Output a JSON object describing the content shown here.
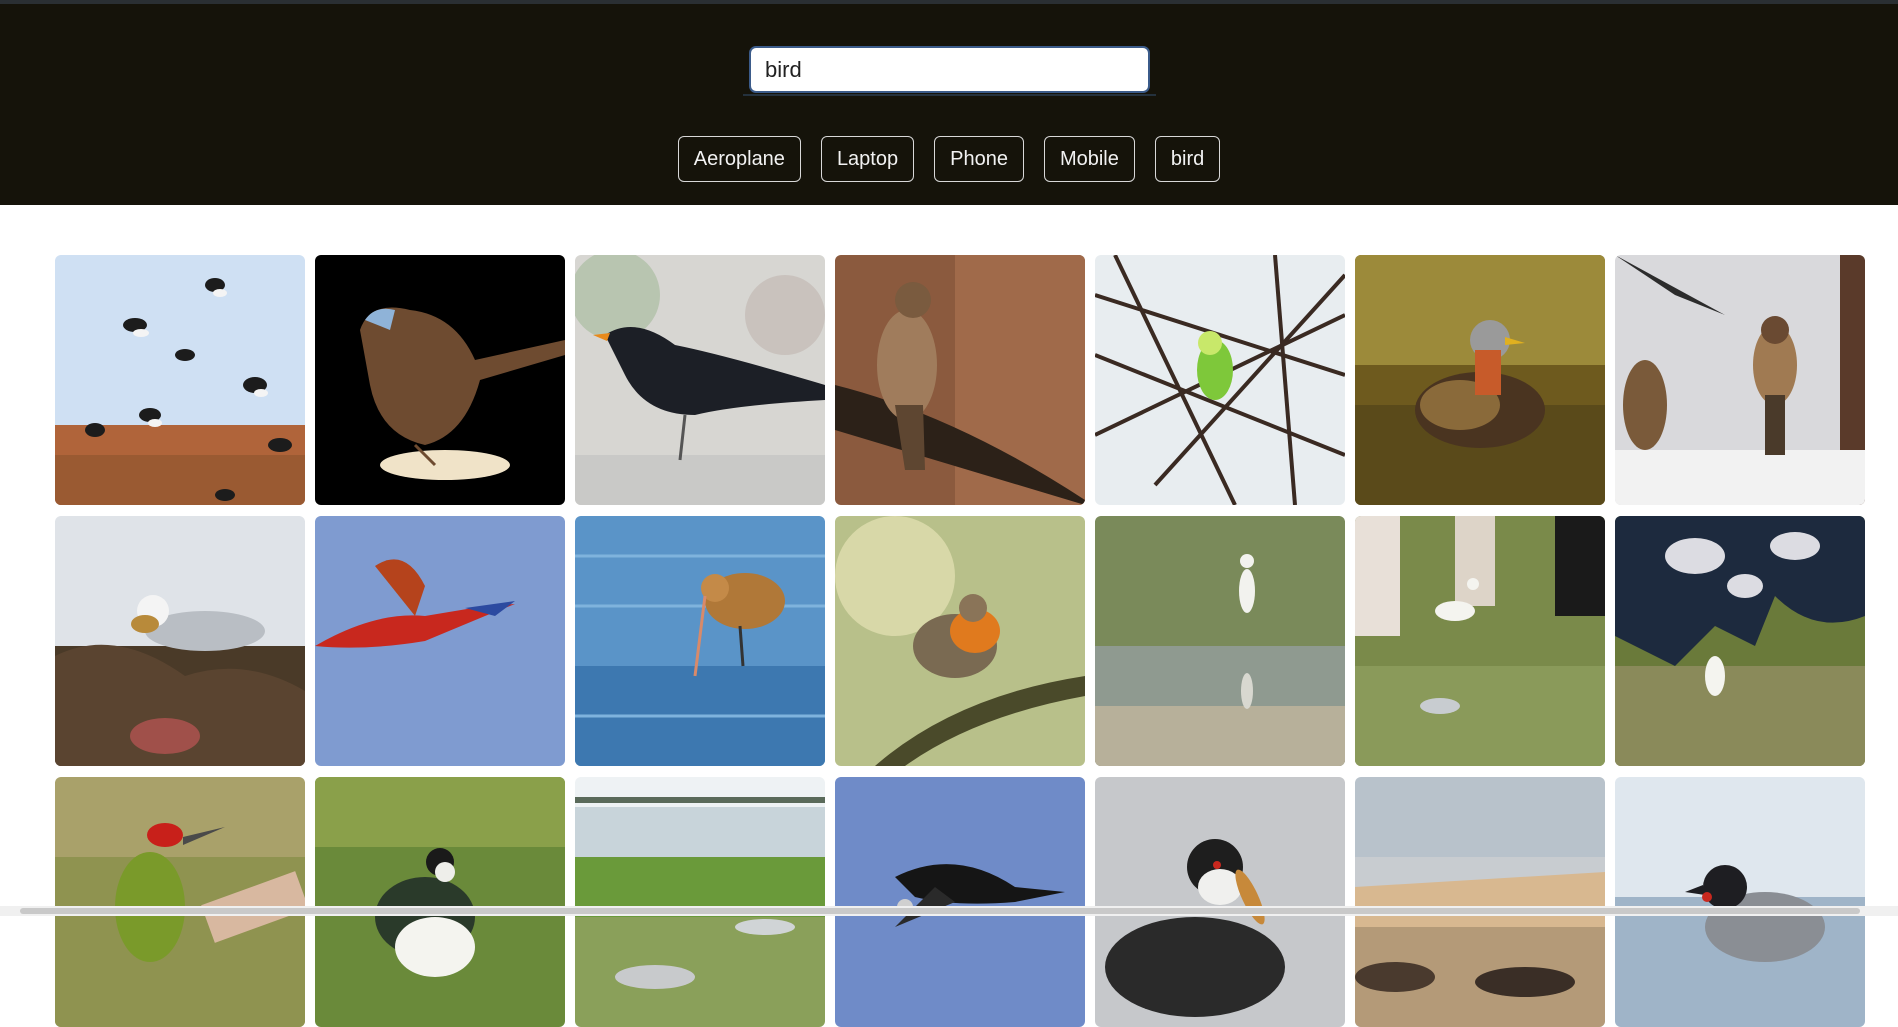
{
  "search": {
    "value": "bird",
    "placeholder": ""
  },
  "quick_searches": [
    "Aeroplane",
    "Laptop",
    "Phone",
    "Mobile",
    "bird"
  ],
  "colors": {
    "header_bg": "#15130a",
    "page_bg": "#ffffff",
    "chip_border": "#d8d8d8"
  },
  "results": [
    {
      "subject": "lapwing-flock-image"
    },
    {
      "subject": "fairy-wren-cutout-image"
    },
    {
      "subject": "blackbird-image"
    },
    {
      "subject": "hawk-on-branch-image"
    },
    {
      "subject": "budgie-in-branches-image"
    },
    {
      "subject": "phalarope-on-water-image"
    },
    {
      "subject": "museum-birds-image"
    },
    {
      "subject": "gull-on-seaweed-image"
    },
    {
      "subject": "macaw-flying-image"
    },
    {
      "subject": "godwit-wading-image"
    },
    {
      "subject": "robin-on-branch-image"
    },
    {
      "subject": "egret-in-marsh-image"
    },
    {
      "subject": "egret-with-cattle-image"
    },
    {
      "subject": "egret-near-cow-image"
    },
    {
      "subject": "woodpecker-image"
    },
    {
      "subject": "lapwing-portrait-image"
    },
    {
      "subject": "tidal-marsh-image"
    },
    {
      "subject": "heron-flying-image"
    },
    {
      "subject": "grebe-with-fish-image"
    },
    {
      "subject": "coastal-cliffs-image"
    },
    {
      "subject": "hooded-crow-image"
    }
  ]
}
